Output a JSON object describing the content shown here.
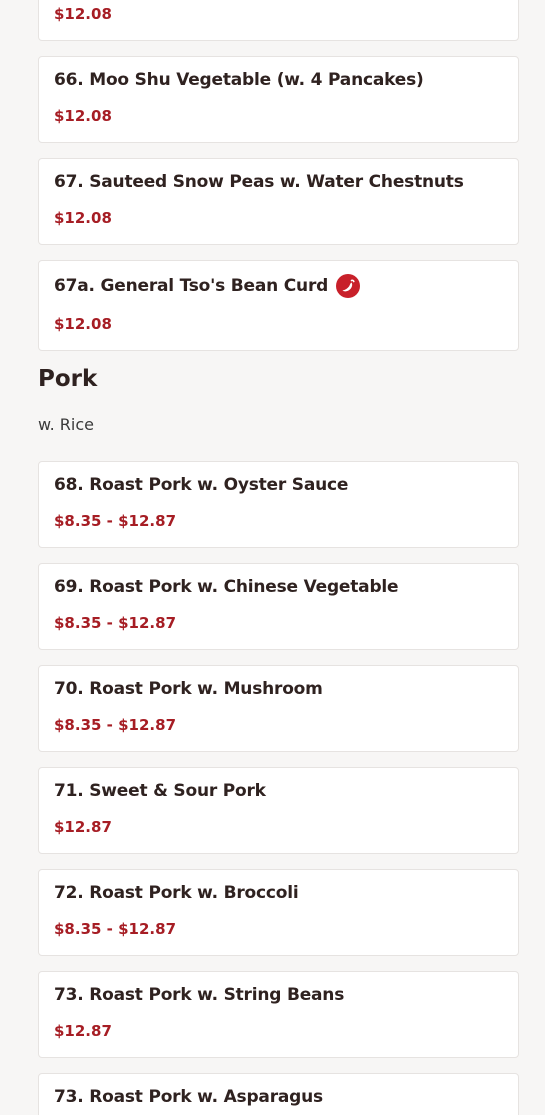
{
  "items_before": [
    {
      "name": "",
      "price": "$12.08"
    },
    {
      "name": "66. Moo Shu Vegetable (w. 4 Pancakes)",
      "price": "$12.08"
    },
    {
      "name": "67. Sauteed Snow Peas w. Water Chestnuts",
      "price": "$12.08"
    },
    {
      "name": "67a. General Tso's Bean Curd",
      "price": "$12.08",
      "icon": "spicy-pepper-icon"
    }
  ],
  "section": {
    "title": "Pork",
    "note": "w. Rice"
  },
  "pork_items": [
    {
      "name": "68. Roast Pork w. Oyster Sauce",
      "price": "$8.35 - $12.87"
    },
    {
      "name": "69. Roast Pork w. Chinese Vegetable",
      "price": "$8.35 - $12.87"
    },
    {
      "name": "70. Roast Pork w. Mushroom",
      "price": "$8.35 - $12.87"
    },
    {
      "name": "71. Sweet & Sour Pork",
      "price": "$12.87"
    },
    {
      "name": "72. Roast Pork w. Broccoli",
      "price": "$8.35 - $12.87"
    },
    {
      "name": "73. Roast Pork w. String Beans",
      "price": "$12.87"
    },
    {
      "name": "73. Roast Pork w. Asparagus",
      "price": ""
    }
  ],
  "colors": {
    "price": "#a61d24",
    "spicy_icon": "#c8202a",
    "background": "#f7f6f5"
  }
}
